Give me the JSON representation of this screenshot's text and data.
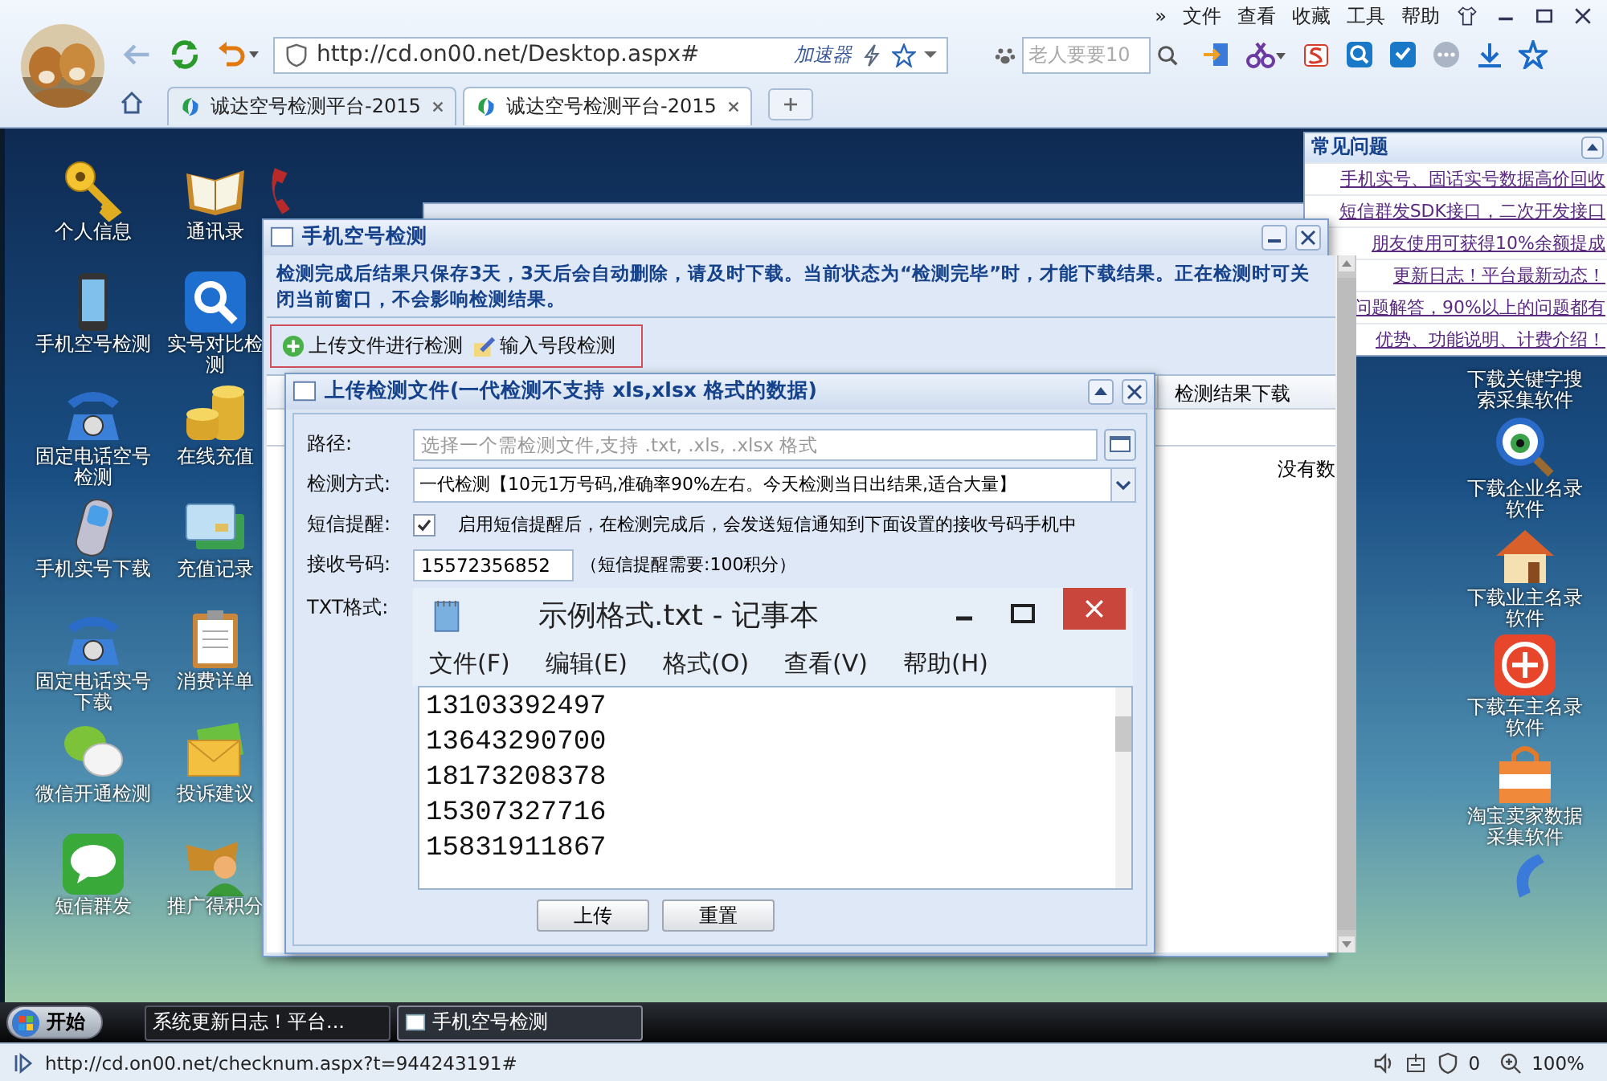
{
  "browser": {
    "menu": [
      "»",
      "文件",
      "查看",
      "收藏",
      "工具",
      "帮助"
    ],
    "address": "http://cd.on00.net/Desktop.aspx#",
    "accelerator": "加速器",
    "search_placeholder": "老人要要10",
    "tabs": [
      {
        "label": "诚达空号检测平台-2015",
        "selected": false
      },
      {
        "label": "诚达空号检测平台-2015",
        "selected": true
      }
    ]
  },
  "desktop": {
    "left_icons": [
      {
        "label": "个人信息",
        "kind": "key"
      },
      {
        "label": "通讯录",
        "kind": "book"
      },
      {
        "label": "手机空号检测",
        "kind": "mobile"
      },
      {
        "label": "实号对比检测",
        "kind": "search"
      },
      {
        "label": "固定电话空号检测",
        "kind": "deskphone"
      },
      {
        "label": "在线充值",
        "kind": "coins"
      },
      {
        "label": "手机实号下载",
        "kind": "cellphone"
      },
      {
        "label": "充值记录",
        "kind": "card"
      },
      {
        "label": "固定电话实号下载",
        "kind": "deskphone"
      },
      {
        "label": "消费详单",
        "kind": "clipboard"
      },
      {
        "label": "微信开通检测",
        "kind": "chat"
      },
      {
        "label": "投诉建议",
        "kind": "mail"
      },
      {
        "label": "短信群发",
        "kind": "sms"
      },
      {
        "label": "推广得积分",
        "kind": "person"
      }
    ],
    "right_icons": [
      {
        "label": "下载关键字搜索采集软件",
        "kind": "none"
      },
      {
        "label": "下载企业名录软件",
        "kind": "eye"
      },
      {
        "label": "下载业主名录软件",
        "kind": "house"
      },
      {
        "label": "下载车主名录软件",
        "kind": "car"
      },
      {
        "label": "淘宝卖家数据采集软件",
        "kind": "bag"
      }
    ]
  },
  "faq": {
    "title": "常见问题",
    "links": [
      "手机实号、固话实号数据高价回收",
      "短信群发SDK接口，二次开发接口",
      "朋友使用可获得10%余额提成",
      "更新日志！平台最新动态！",
      "问题解答，90%以上的问题都有",
      "优势、功能说明、计费介绍！"
    ]
  },
  "main_window": {
    "title": "手机空号检测",
    "notice": "检测完成后结果只保存3天，3天后会自动删除，请及时下载。当前状态为“检测完毕”时，才能下载结果。正在检测时可关闭当前窗口，不会影响检测结果。",
    "toolbar": [
      "上传文件进行检测",
      "输入号段检测"
    ],
    "columns": [
      "检测结果下载"
    ],
    "empty_text": "没有数"
  },
  "upload_dialog": {
    "title": "上传检测文件(一代检测不支持 xls,xlsx 格式的数据)",
    "path_label": "路径:",
    "path_placeholder": "选择一个需检测文件,支持 .txt, .xls, .xlsx 格式",
    "method_label": "检测方式:",
    "method_value": "一代检测【10元1万号码,准确率90%左右。今天检测当日出结果,适合大量】",
    "sms_label": "短信提醒:",
    "sms_checked": true,
    "sms_text": "启用短信提醒后，在检测完成后，会发送短信通知到下面设置的接收号码手机中",
    "phone_label": "接收号码:",
    "phone_value": "15572356852",
    "phone_note": "（短信提醒需要:100积分）",
    "txt_label": "TXT格式:",
    "notepad": {
      "title": "示例格式.txt - 记事本",
      "menu": [
        "文件(F)",
        "编辑(E)",
        "格式(O)",
        "查看(V)",
        "帮助(H)"
      ],
      "lines": [
        "13103392497",
        "13643290700",
        "18173208378",
        "15307327716",
        "15831911867"
      ]
    },
    "buttons": [
      "上传",
      "重置"
    ]
  },
  "taskbar": {
    "start": "开始",
    "tasks": [
      {
        "label": "系统更新日志！平台...",
        "selected": false
      },
      {
        "label": "手机空号检测",
        "selected": true
      }
    ]
  },
  "status_bar": {
    "url": "http://cd.on00.net/checknum.aspx?t=944243191#",
    "shield_count": "0",
    "zoom": "100%"
  }
}
